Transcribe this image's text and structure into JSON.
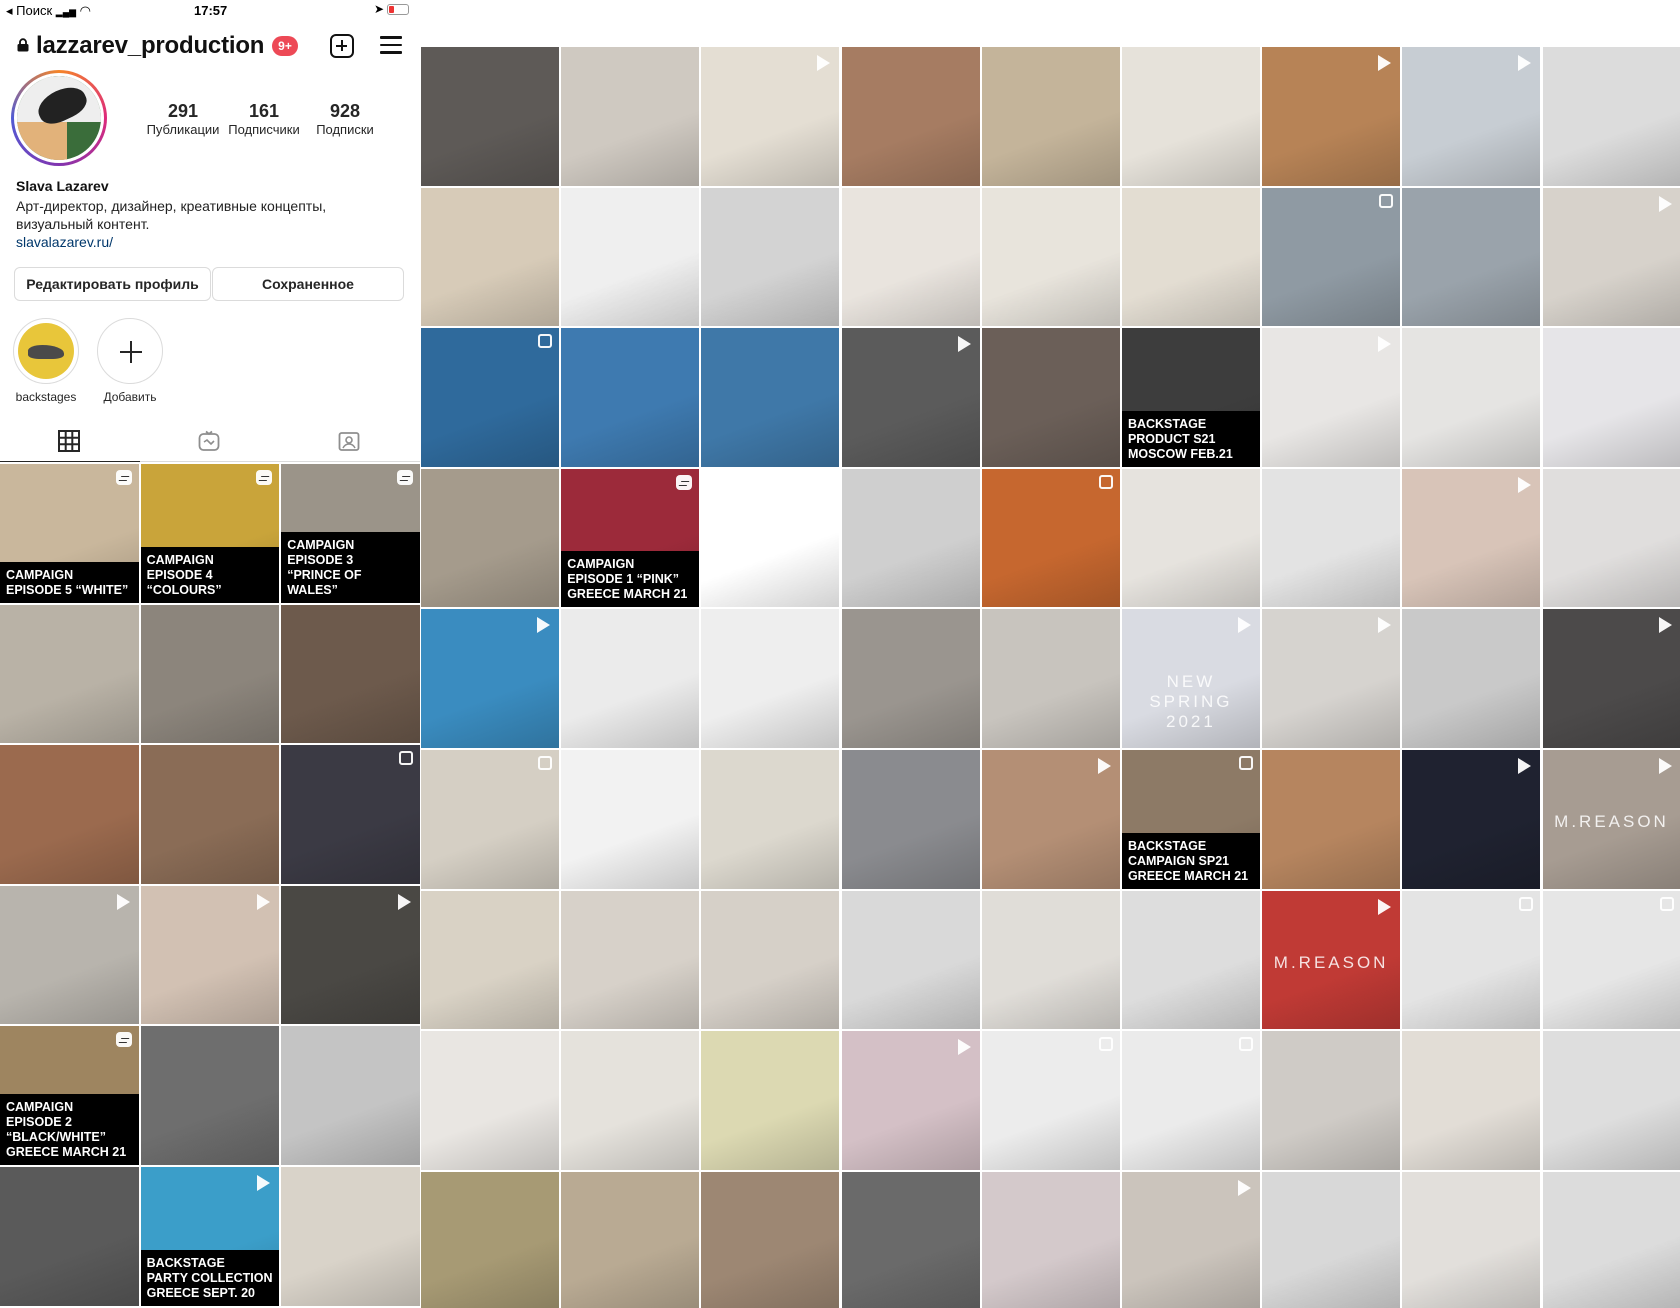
{
  "status_bar": {
    "back_label": "◂ Поиск",
    "signal": "▂▄▆",
    "wifi": "◠",
    "time": "17:57",
    "location": "➤"
  },
  "profile": {
    "handle": "lazzarev_production",
    "notification_count": "9+",
    "name": "Slava Lazarev",
    "bio": "Арт-директор, дизайнер, креативные концепты, визуальный контент.",
    "website": "slavalazarev.ru/",
    "stats": [
      {
        "value": "291",
        "label": "Публикации"
      },
      {
        "value": "161",
        "label": "Подписчики"
      },
      {
        "value": "928",
        "label": "Подписки"
      }
    ],
    "edit_button": "Редактировать профиль",
    "saved_button": "Сохраненное",
    "highlights": [
      {
        "label": "backstages"
      },
      {
        "label": "Добавить"
      }
    ]
  },
  "tabs": [
    {
      "name": "grid-icon"
    },
    {
      "name": "igtv-icon"
    },
    {
      "name": "tagged-icon"
    }
  ],
  "colors": {
    "accent_badge": "#ed4956",
    "link": "#00376b",
    "border": "#dbdbdb"
  },
  "left_grid": [
    {
      "bg": "#c9b79c",
      "badge": "igtv",
      "caption": "CAMPAIGN\nEPISODE 5 “WHITE”"
    },
    {
      "bg": "#c9a43a",
      "badge": "igtv",
      "caption": "CAMPAIGN\nEPISODE 4\n“COLOURS”"
    },
    {
      "bg": "#9b9489",
      "badge": "igtv",
      "caption": "CAMPAIGN\nEPISODE 3\n“PRINCE OF WALES”"
    },
    {
      "bg": "#b9b2a6"
    },
    {
      "bg": "#8c857c"
    },
    {
      "bg": "#6d5a4c"
    },
    {
      "bg": "#9b6a4e"
    },
    {
      "bg": "#8a6c56"
    },
    {
      "bg": "#3b3a44",
      "badge": "multi"
    },
    {
      "bg": "#b8b4ad",
      "badge": "video"
    },
    {
      "bg": "#d2c1b3",
      "badge": "video"
    },
    {
      "bg": "#4a4844",
      "badge": "video"
    },
    {
      "bg": "#9e8560",
      "badge": "igtv",
      "caption": "CAMPAIGN\nEPISODE 2\n“BLACK/WHITE”\nGREECE MARCH 21"
    },
    {
      "bg": "#6e6e6e"
    },
    {
      "bg": "#c4c4c4"
    },
    {
      "bg": "#5a5a5a"
    },
    {
      "bg": "#3b9ec9",
      "badge": "video",
      "caption": "BACKSTAGE\nPARTY COLLECTION\nGREECE SEPT. 20"
    },
    {
      "bg": "#d9d3c9"
    }
  ],
  "main_grid": [
    {
      "bg": "#5e5a57"
    },
    {
      "bg": "#cfc9c1"
    },
    {
      "bg": "#e4ded3",
      "badge": "video"
    },
    {
      "bg": "#a67c62"
    },
    {
      "bg": "#c4b49a"
    },
    {
      "bg": "#e6e2da"
    },
    {
      "bg": "#b78356",
      "badge": "video"
    },
    {
      "bg": "#c7cdd3",
      "badge": "video"
    },
    {
      "bg": "#dcdcdc"
    },
    {
      "bg": "#d7cbb8"
    },
    {
      "bg": "#efefef"
    },
    {
      "bg": "#d3d3d3"
    },
    {
      "bg": "#e9e4de"
    },
    {
      "bg": "#e8e4dc"
    },
    {
      "bg": "#e3ddd2"
    },
    {
      "bg": "#8f9aa3",
      "badge": "multi"
    },
    {
      "bg": "#9aa3ab"
    },
    {
      "bg": "#d7d2cb",
      "badge": "video"
    },
    {
      "bg": "#2f6a9c",
      "badge": "multi"
    },
    {
      "bg": "#3e7ab0"
    },
    {
      "bg": "#3f78a8"
    },
    {
      "bg": "#5b5b5b",
      "badge": "video"
    },
    {
      "bg": "#6b5f58"
    },
    {
      "bg": "#3d3d3d",
      "caption": "BACKSTAGE\nPRODUCT S21\nMOSCOW FEB.21"
    },
    {
      "bg": "#e8e6e4",
      "badge": "video"
    },
    {
      "bg": "#e5e4e2"
    },
    {
      "bg": "#e6e5e8"
    },
    {
      "bg": "#a59b8c"
    },
    {
      "bg": "#9c2a3a",
      "badge": "igtv",
      "caption": "CAMPAIGN\nEPISODE 1 “PINK”\nGREECE MARCH 21"
    },
    {
      "bg": "#ffffff",
      "badge": "multi"
    },
    {
      "bg": "#cfcfcf"
    },
    {
      "bg": "#c6672f",
      "badge": "multi"
    },
    {
      "bg": "#e6e3de"
    },
    {
      "bg": "#e3e3e3"
    },
    {
      "bg": "#d8c4b8",
      "badge": "video"
    },
    {
      "bg": "#e0dedd"
    },
    {
      "bg": "#3a8cc0",
      "badge": "video"
    },
    {
      "bg": "#ebebeb"
    },
    {
      "bg": "#eeeeee"
    },
    {
      "bg": "#9a958f"
    },
    {
      "bg": "#c8c4be"
    },
    {
      "bg": "#d9dbe2",
      "badge": "video",
      "text": "NEW SPRING 2021"
    },
    {
      "bg": "#d6d3cf",
      "badge": "video"
    },
    {
      "bg": "#c9c9c9"
    },
    {
      "bg": "#4c4a4a",
      "badge": "video"
    },
    {
      "bg": "#d5cfc4",
      "badge": "multi"
    },
    {
      "bg": "#f2f2f2"
    },
    {
      "bg": "#dcd8ce"
    },
    {
      "bg": "#8a8b8f"
    },
    {
      "bg": "#b48f75",
      "badge": "video"
    },
    {
      "bg": "#8d7a66",
      "badge": "multi",
      "caption": "BACKSTAGE\nCAMPAIGN SP21\nGREECE MARCH 21"
    },
    {
      "bg": "#b6855f"
    },
    {
      "bg": "#1f2230",
      "badge": "video"
    },
    {
      "bg": "#a79c92",
      "badge": "video",
      "text": "M.REASON"
    },
    {
      "bg": "#d9d2c5"
    },
    {
      "bg": "#d7d1c9"
    },
    {
      "bg": "#d6d0c8"
    },
    {
      "bg": "#d9d9d9"
    },
    {
      "bg": "#e0ddd8"
    },
    {
      "bg": "#dddddd"
    },
    {
      "bg": "#c03a35",
      "badge": "video",
      "text": "M.REASON"
    },
    {
      "bg": "#e4e4e4",
      "badge": "multi"
    },
    {
      "bg": "#e6e6e6",
      "badge": "multi"
    },
    {
      "bg": "#e9e6e2"
    },
    {
      "bg": "#e5e2dc"
    },
    {
      "bg": "#dcd9b2"
    },
    {
      "bg": "#d4c0c6",
      "badge": "video"
    },
    {
      "bg": "#ececec",
      "badge": "multi"
    },
    {
      "bg": "#ebebeb",
      "badge": "multi"
    },
    {
      "bg": "#cfcbc6"
    },
    {
      "bg": "#e2ddd6"
    },
    {
      "bg": "#dedede"
    },
    {
      "bg": "#a79a74"
    },
    {
      "bg": "#b9aa93"
    },
    {
      "bg": "#9d8773"
    },
    {
      "bg": "#6a6a6a"
    },
    {
      "bg": "#d4c9cb"
    },
    {
      "bg": "#cbc4bc",
      "badge": "video"
    },
    {
      "bg": "#d8d8d8"
    },
    {
      "bg": "#e2dfdb"
    },
    {
      "bg": "#dcdcdc"
    }
  ]
}
